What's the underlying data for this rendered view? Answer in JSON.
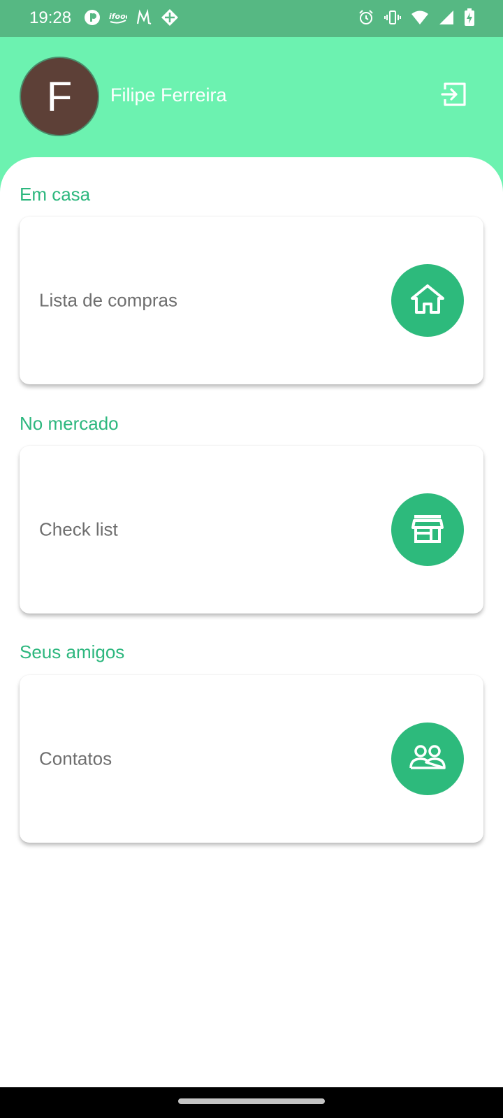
{
  "status_bar": {
    "time": "19:28",
    "left_icons": [
      "app-notification-icon",
      "ifood-icon",
      "m-app-icon",
      "diamond-app-icon"
    ],
    "right_icons": [
      "alarm-icon",
      "vibrate-icon",
      "wifi-icon",
      "signal-icon",
      "battery-charging-icon"
    ]
  },
  "header": {
    "avatar_initial": "F",
    "user_name": "Filipe Ferreira",
    "logout_icon": "logout-icon"
  },
  "sections": [
    {
      "title": "Em casa",
      "card_label": "Lista de compras",
      "icon": "home-icon"
    },
    {
      "title": "No mercado",
      "card_label": "Check list",
      "icon": "store-icon"
    },
    {
      "title": "Seus amigos",
      "card_label": "Contatos",
      "icon": "people-icon"
    }
  ],
  "colors": {
    "header_background": "#6cf2b0",
    "status_bar": "#56b883",
    "accent": "#2db77e",
    "avatar": "#5d4037",
    "card_text": "#6e6e6e"
  }
}
